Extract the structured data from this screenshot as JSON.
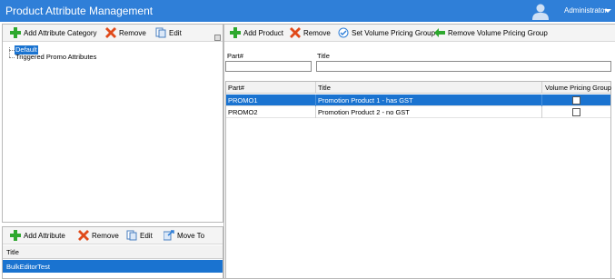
{
  "header": {
    "title": "Product Attribute Management",
    "user_name": "Administrator",
    "bg_color": "#2f7fd8"
  },
  "categories": {
    "toolbar": {
      "add_label": "Add Attribute Category",
      "remove_label": "Remove",
      "edit_label": "Edit"
    },
    "tree": [
      {
        "label": "Default",
        "selected": true
      },
      {
        "label": "Triggered Promo Attributes",
        "selected": false
      }
    ]
  },
  "attributes": {
    "toolbar": {
      "add_label": "Add Attribute",
      "remove_label": "Remove",
      "edit_label": "Edit",
      "move_label": "Move To"
    },
    "column_title": "Title",
    "rows": [
      {
        "title": "BulkEditorTest",
        "selected": true
      }
    ]
  },
  "products": {
    "toolbar": {
      "add_label": "Add Product",
      "remove_label": "Remove",
      "set_vpg_label": "Set Volume Pricing Group",
      "remove_vpg_label": "Remove Volume Pricing Group"
    },
    "filters": {
      "part_label": "Part#",
      "title_label": "Title",
      "part_value": "",
      "title_value": ""
    },
    "columns": {
      "part": "Part#",
      "title": "Title",
      "vpg": "Volume Pricing Group"
    },
    "rows": [
      {
        "part": "PROMO1",
        "title": "Promotion Product 1 - has GST",
        "vpg": false,
        "selected": true
      },
      {
        "part": "PROMO2",
        "title": "Promotion Product 2 - no GST",
        "vpg": false,
        "selected": false
      }
    ]
  },
  "colors": {
    "selection": "#1a73d0",
    "add_green": "#2ea82e",
    "remove_red": "#e04a1a"
  }
}
